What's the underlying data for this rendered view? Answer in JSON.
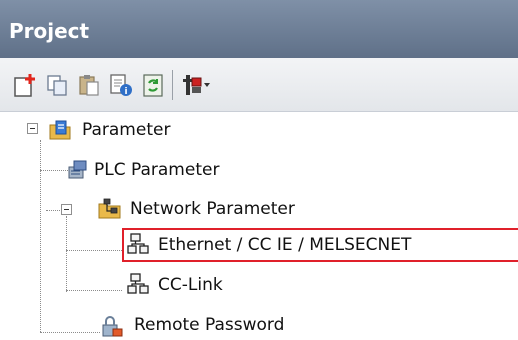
{
  "panel": {
    "title": "Project"
  },
  "toolbar": {
    "buttons": [
      {
        "icon": "new-data-icon"
      },
      {
        "icon": "copy-icon"
      },
      {
        "icon": "paste-icon"
      },
      {
        "icon": "properties-icon"
      },
      {
        "icon": "refresh-icon"
      },
      {
        "icon": "tools-dropdown-icon"
      }
    ]
  },
  "tree": {
    "root": {
      "label": "Parameter",
      "icon": "parameter-folder-icon"
    },
    "plc_parameter": {
      "label": "PLC Parameter",
      "icon": "plc-parameter-icon"
    },
    "network_parameter": {
      "label": "Network Parameter",
      "icon": "network-parameter-icon"
    },
    "ethernet": {
      "label": "Ethernet / CC IE / MELSECNET",
      "icon": "network-node-icon"
    },
    "cc_link": {
      "label": "CC-Link",
      "icon": "network-node-icon"
    },
    "remote_password": {
      "label": "Remote Password",
      "icon": "remote-password-icon"
    }
  },
  "colors": {
    "header": "#6f809a",
    "highlight": "#e0202a"
  }
}
